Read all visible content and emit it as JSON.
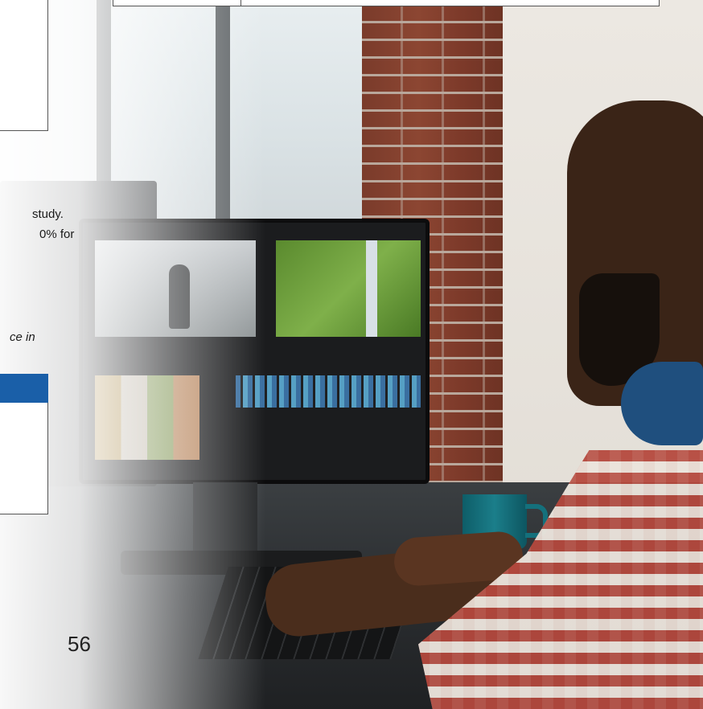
{
  "document": {
    "text_line1": "study.",
    "text_line2": "0% for",
    "text_italic": "ce in",
    "page_number": "56"
  },
  "colors": {
    "accent_bar": "#1a5fa8"
  }
}
